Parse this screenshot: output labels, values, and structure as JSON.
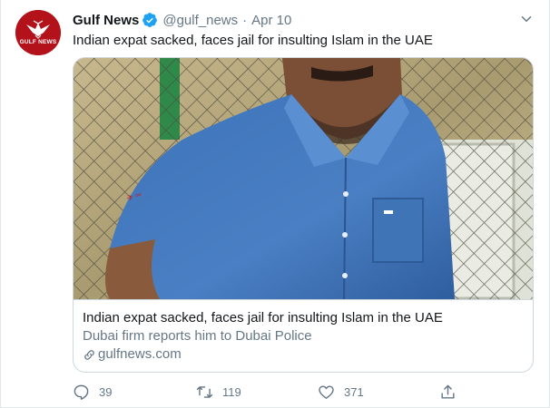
{
  "tweet": {
    "author_name": "Gulf News",
    "avatar_text": "GULF NEWS",
    "handle": "@gulf_news",
    "separator": "·",
    "date": "Apr 10",
    "text": "Indian expat sacked, faces jail for insulting Islam in the UAE"
  },
  "card": {
    "title": "Indian expat sacked, faces jail for insulting Islam in the UAE",
    "description": "Dubai firm reports him to Dubai Police",
    "domain": "gulfnews.com"
  },
  "actions": {
    "replies": "39",
    "retweets": "119",
    "likes": "371"
  },
  "icons": {
    "verified": "verified-badge-icon",
    "caret": "chevron-down-icon",
    "link": "link-icon",
    "reply": "reply-icon",
    "retweet": "retweet-icon",
    "like": "heart-icon",
    "share": "share-icon"
  },
  "colors": {
    "accent": "#1da1f2",
    "secondary_text": "#657786",
    "primary_text": "#14171a",
    "brand_red": "#b3121b"
  }
}
